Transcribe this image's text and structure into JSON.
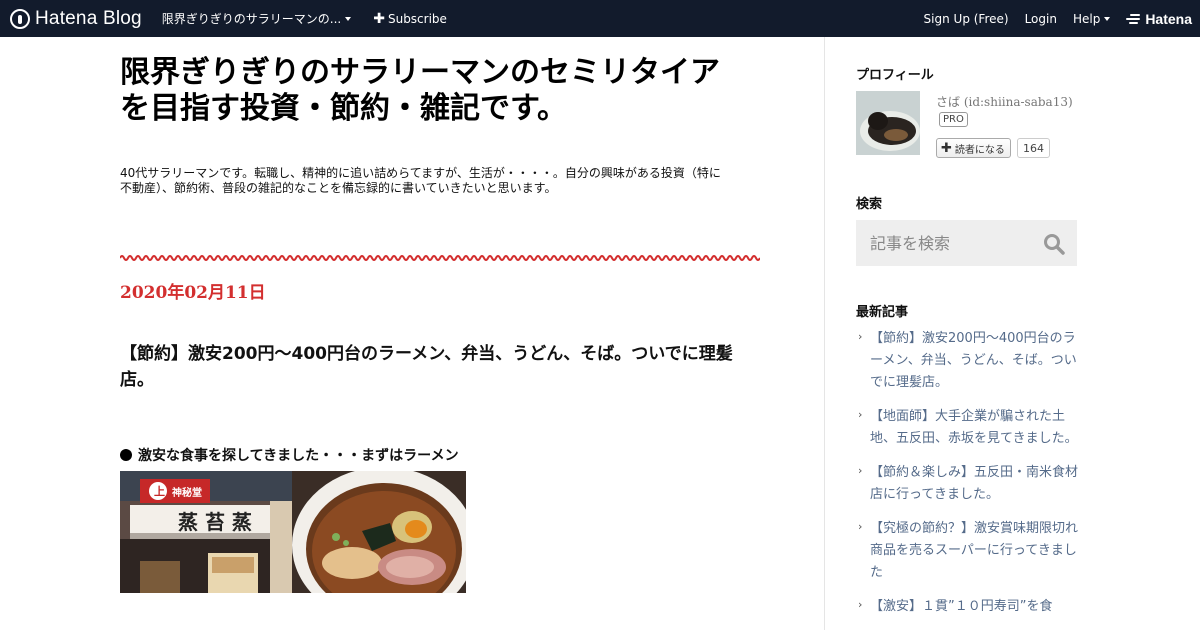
{
  "topbar": {
    "logo_text": "Hatena Blog",
    "blog_selector": "限界ぎりぎりのサラリーマンの...",
    "subscribe": "Subscribe",
    "signup": "Sign Up (Free)",
    "login": "Login",
    "help": "Help",
    "brand": "Hatena"
  },
  "blog": {
    "title": "限界ぎりぎりのサラリーマンのセミリタイアを目指す投資・節約・雑記です。",
    "description": "40代サラリーマンです。転職し、精神的に追い詰めらてますが、生活が・・・・。自分の興味がある投資（特に不動産）、節約術、普段の雑記的なことを備忘録的に書いていきたいと思います。"
  },
  "entry": {
    "date": "2020年02月11日",
    "title": "【節約】激安200円～400円台のラーメン、弁当、うどん、そば。ついでに理髪店。",
    "section_heading": "激安な食事を探してきました・・・まずはラーメン",
    "shop_sign_top": "神秘堂",
    "shop_sign_main": "蒸 苔 蒸"
  },
  "sidebar": {
    "profile": {
      "heading": "プロフィール",
      "name": "さば (id:shiina-saba13)",
      "pro_badge": "PRO",
      "reader_button": "読者になる",
      "reader_count": "164"
    },
    "search": {
      "heading": "検索",
      "placeholder": "記事を検索"
    },
    "recent": {
      "heading": "最新記事",
      "items": [
        "【節約】激安200円～400円台のラーメン、弁当、うどん、そば。ついでに理髪店。",
        "【地面師】大手企業が騙された土地、五反田、赤坂を見てきました。",
        "【節約＆楽しみ】五反田・南米食材店に行ってきました。",
        "【究極の節約？】激安賞味期限切れ商品を売るスーパーに行ってきました",
        "【激安】１貫”１０円寿司”を食"
      ]
    }
  },
  "colors": {
    "topbar": "#121b2c",
    "date_red": "#d32f2f",
    "link_blue": "#556b8a"
  }
}
